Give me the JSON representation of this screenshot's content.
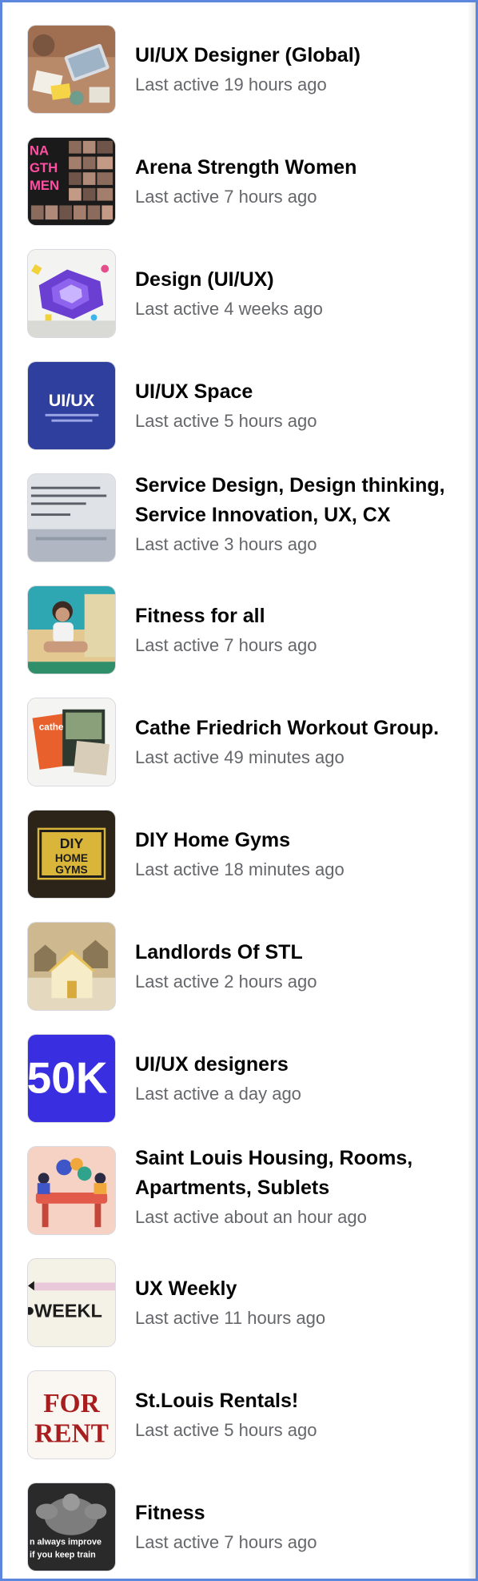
{
  "groups": [
    {
      "name": "UI/UX Designer (Global)",
      "meta": "Last active 19 hours ago",
      "thumb": "desk-workspace-photo"
    },
    {
      "name": "Arena Strength Women",
      "meta": "Last active 7 hours ago",
      "thumb": "arena-strength-collage",
      "thumb_text": [
        "NA",
        "GTH",
        "MEN"
      ]
    },
    {
      "name": "Design (UI/UX)",
      "meta": "Last active 4 weeks ago",
      "thumb": "isometric-purple-illustration"
    },
    {
      "name": "UI/UX Space",
      "meta": "Last active 5 hours ago",
      "thumb": "ui-ux-space-logo",
      "thumb_text": [
        "UI/UX"
      ]
    },
    {
      "name_lines": [
        "Service Design, Design thinking,",
        "Service Innovation, UX, CX"
      ],
      "meta": "Last active 3 hours ago",
      "thumb": "typewriter-quote-photo"
    },
    {
      "name": "Fitness for all",
      "meta": "Last active 7 hours ago",
      "thumb": "woman-sitting-photo"
    },
    {
      "name": "Cathe Friedrich Workout Group.",
      "meta": "Last active 49 minutes ago",
      "thumb": "workout-dvd-covers",
      "thumb_text": [
        "cathe"
      ]
    },
    {
      "name": "DIY Home Gyms",
      "meta": "Last active 18 minutes ago",
      "thumb": "diy-home-gyms-logo",
      "thumb_text": [
        "DIY",
        "HOME",
        "GYMS"
      ]
    },
    {
      "name": "Landlords Of STL",
      "meta": "Last active 2 hours ago",
      "thumb": "house-models-photo"
    },
    {
      "name": "UI/UX designers",
      "meta": "Last active a day ago",
      "thumb": "150k-badge",
      "thumb_text": [
        "50K"
      ]
    },
    {
      "name_lines": [
        "Saint Louis Housing, Rooms,",
        "Apartments, Sublets"
      ],
      "meta": "Last active about an hour ago",
      "thumb": "people-table-illustration"
    },
    {
      "name": "UX Weekly",
      "meta": "Last active 11 hours ago",
      "thumb": "ux-weekly-logo",
      "thumb_text": [
        "WEEKL"
      ]
    },
    {
      "name": "St.Louis Rentals!",
      "meta": "Last active 5 hours ago",
      "thumb": "for-rent-sign",
      "thumb_text": [
        "FOR",
        "RENT"
      ]
    },
    {
      "name": "Fitness",
      "meta": "Last active 7 hours ago",
      "thumb": "bodybuilder-quote-photo",
      "thumb_text": [
        "n always improve",
        "if you keep train"
      ]
    }
  ]
}
